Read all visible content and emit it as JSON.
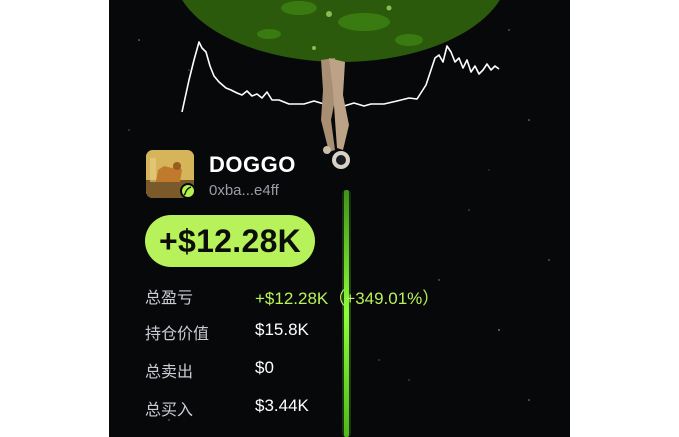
{
  "token": {
    "name": "DOGGO",
    "address": "0xba...e4ff",
    "avatar_icon": "doggo-token-avatar",
    "badge_icon": "feather-pen-icon"
  },
  "pnl_headline": "+$12.28K",
  "stats": [
    {
      "label": "总盈亏",
      "value": "+$12.28K（+349.01%）"
    },
    {
      "label": "持仓价值",
      "value": "$15.8K"
    },
    {
      "label": "总卖出",
      "value": "$0"
    },
    {
      "label": "总买入",
      "value": "$3.44K"
    }
  ],
  "colors": {
    "accent_green": "#b8f25a",
    "background": "#07080a",
    "planet_green": "#76d42c"
  }
}
